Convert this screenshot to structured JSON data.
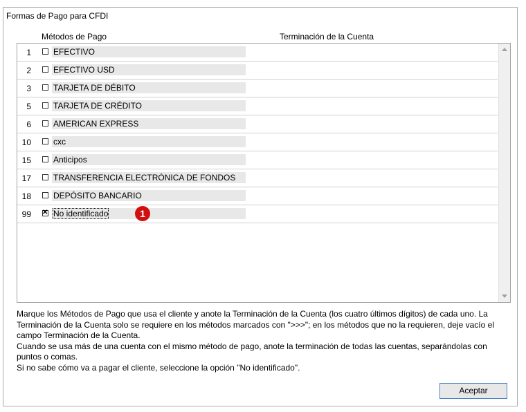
{
  "window": {
    "title": "Formas de Pago para CFDI"
  },
  "columns": {
    "methods": "Métodos de Pago",
    "account": "Terminación de la Cuenta"
  },
  "rows": [
    {
      "num": "1",
      "label": "EFECTIVO",
      "checked": false
    },
    {
      "num": "2",
      "label": "EFECTIVO USD",
      "checked": false
    },
    {
      "num": "3",
      "label": "TARJETA DE DÉBITO",
      "checked": false
    },
    {
      "num": "5",
      "label": "TARJETA DE CRÉDITO",
      "checked": false
    },
    {
      "num": "6",
      "label": "AMERICAN EXPRESS",
      "checked": false
    },
    {
      "num": "10",
      "label": "cxc",
      "checked": false
    },
    {
      "num": "15",
      "label": "Anticipos",
      "checked": false
    },
    {
      "num": "17",
      "label": "TRANSFERENCIA ELECTRÓNICA DE FONDOS",
      "checked": false
    },
    {
      "num": "18",
      "label": "DEPÓSITO BANCARIO",
      "checked": false
    },
    {
      "num": "99",
      "label": "No identificado",
      "checked": true
    }
  ],
  "annotation": {
    "marker": "1",
    "color": "#d01010"
  },
  "notes": [
    "Marque los Métodos de Pago que usa el cliente y anote la Terminación de la Cuenta (los cuatro últimos dígitos) de cada uno. La Terminación de la Cuenta solo se requiere en los métodos marcados con \">>>\"; en los métodos que no la requieren, deje vacío el campo Terminación de la Cuenta.",
    "Cuando se usa más de una cuenta con el mismo método de pago, anote la terminación de todas las cuentas, separándolas con puntos o comas.",
    "Si no sabe cómo va a pagar el cliente, seleccione la opción \"No identificado\"."
  ],
  "buttons": {
    "accept": "Aceptar"
  }
}
